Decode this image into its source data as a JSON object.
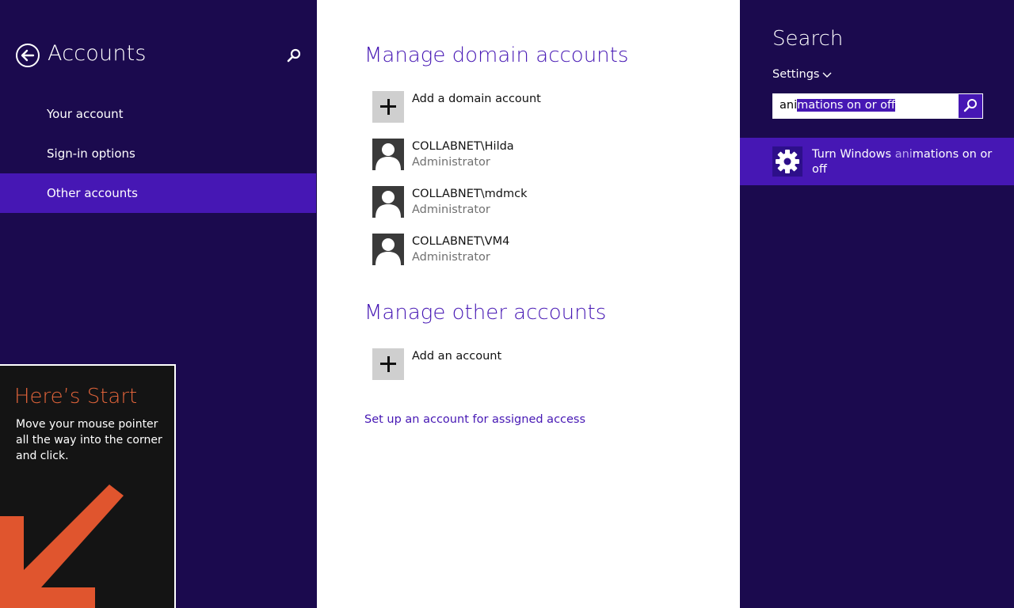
{
  "left_pane": {
    "title": "Accounts",
    "nav_items": [
      {
        "label": "Your account"
      },
      {
        "label": "Sign-in options"
      },
      {
        "label": "Other accounts",
        "selected": true
      }
    ],
    "icons": {
      "back": "back-arrow-icon",
      "search": "search-icon"
    }
  },
  "tip": {
    "title": "Here’s Start",
    "text": "Move your mouse pointer all the way into the corner and click.",
    "arrow_color": "#e0552e"
  },
  "middle_pane": {
    "domain_section_title": "Manage domain accounts",
    "add_domain_label": "Add a domain account",
    "domain_accounts": [
      {
        "name": "COLLABNET\\Hilda",
        "role": "Administrator"
      },
      {
        "name": "COLLABNET\\mdmck",
        "role": "Administrator"
      },
      {
        "name": "COLLABNET\\VM4",
        "role": "Administrator"
      }
    ],
    "other_section_title": "Manage other accounts",
    "add_account_label": "Add an account",
    "assigned_access_link": "Set up an account for assigned access"
  },
  "right_pane": {
    "title": "Search",
    "scope": "Settings",
    "search_query_typed": "ani",
    "search_query_autocomplete": "mations on or off",
    "result": {
      "text_before": "Turn Windows ",
      "text_match": "ani",
      "text_after": "mations on or off",
      "icon": "gear-icon"
    }
  },
  "colors": {
    "accent": "#4617b4",
    "background": "#1b0a4e",
    "tip_title": "#e0633a"
  }
}
